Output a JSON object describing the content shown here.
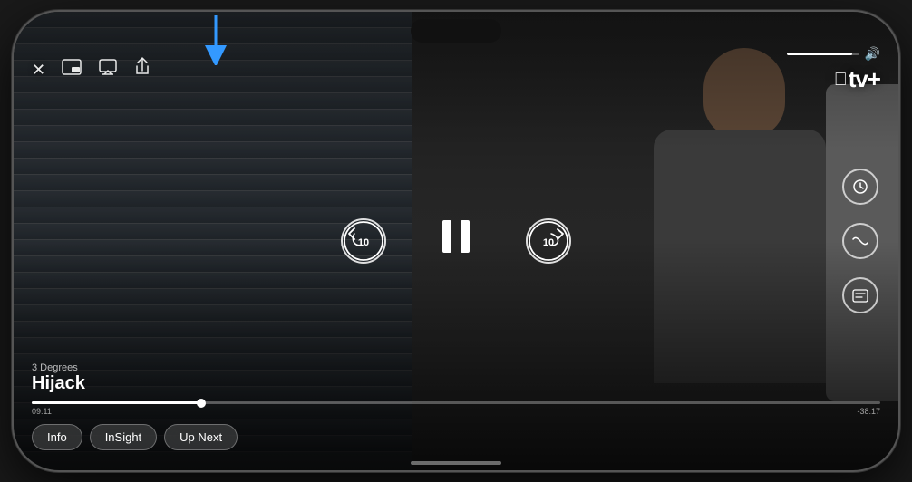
{
  "phone": {
    "title": "iPhone"
  },
  "video": {
    "show_season": "3 Degrees",
    "show_title": "Hijack",
    "time_elapsed": "09:11",
    "time_remaining": "-38:17",
    "progress_percent": 20,
    "volume_percent": 90
  },
  "controls": {
    "close_label": "✕",
    "pip_label": "⊡",
    "airplay_label": "⬜",
    "share_label": "⬆",
    "skip_back_seconds": "10",
    "skip_fwd_seconds": "10",
    "pause_label": "⏸",
    "volume_label": "🔊",
    "appletv_label": "tv+",
    "apple_symbol": ""
  },
  "bottom_buttons": [
    {
      "id": "info",
      "label": "Info"
    },
    {
      "id": "insight",
      "label": "InSight"
    },
    {
      "id": "up-next",
      "label": "Up Next"
    }
  ],
  "right_controls": [
    {
      "id": "speed",
      "label": "⏱",
      "icon": "speedometer-icon"
    },
    {
      "id": "audio",
      "label": "〜",
      "icon": "audio-wave-icon"
    },
    {
      "id": "subtitles",
      "label": "💬",
      "icon": "subtitles-icon"
    }
  ],
  "annotation": {
    "arrow_color": "#3399ff",
    "arrow_label": "AirPlay button indicator"
  }
}
